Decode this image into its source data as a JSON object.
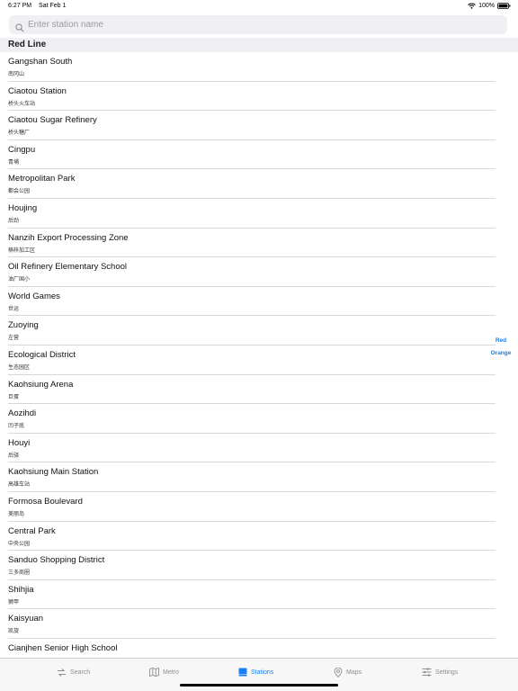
{
  "status_bar": {
    "time": "6:27 PM",
    "date": "Sat Feb 1",
    "battery": "100%"
  },
  "search": {
    "placeholder": "Enter station name",
    "value": ""
  },
  "section": {
    "title": "Red Line"
  },
  "stations": [
    {
      "name": "Gangshan South",
      "sub": "南冈山"
    },
    {
      "name": "Ciaotou Station",
      "sub": "桥头火车站"
    },
    {
      "name": "Ciaotou Sugar Refinery",
      "sub": "桥头糖厂"
    },
    {
      "name": "Cingpu",
      "sub": "青埔"
    },
    {
      "name": "Metropolitan Park",
      "sub": "都会公园"
    },
    {
      "name": "Houjing",
      "sub": "后劲"
    },
    {
      "name": "Nanzih Export Processing Zone",
      "sub": "楠梓加工区"
    },
    {
      "name": "Oil Refinery Elementary School",
      "sub": "油厂国小"
    },
    {
      "name": "World Games",
      "sub": "世运"
    },
    {
      "name": "Zuoying",
      "sub": "左营"
    },
    {
      "name": "Ecological District",
      "sub": "生态园区"
    },
    {
      "name": "Kaohsiung Arena",
      "sub": "巨蛋"
    },
    {
      "name": "Aozihdi",
      "sub": "凹子底"
    },
    {
      "name": "Houyi",
      "sub": "后驿"
    },
    {
      "name": "Kaohsiung Main Station",
      "sub": "高雄车站"
    },
    {
      "name": "Formosa Boulevard",
      "sub": "美丽岛"
    },
    {
      "name": "Central Park",
      "sub": "中央公园"
    },
    {
      "name": "Sanduo Shopping District",
      "sub": "三多商圈"
    },
    {
      "name": "Shihjia",
      "sub": "狮甲"
    },
    {
      "name": "Kaisyuan",
      "sub": "凯旋"
    },
    {
      "name": "Cianjhen Senior High School",
      "sub": ""
    }
  ],
  "side_index": [
    "Red",
    "Orange"
  ],
  "tabs": [
    {
      "label": "Search",
      "icon": "search-tab-icon",
      "active": false
    },
    {
      "label": "Metro",
      "icon": "map-tab-icon",
      "active": false
    },
    {
      "label": "Stations",
      "icon": "book-tab-icon",
      "active": true
    },
    {
      "label": "Maps",
      "icon": "pin-tab-icon",
      "active": false
    },
    {
      "label": "Settings",
      "icon": "sliders-tab-icon",
      "active": false
    }
  ],
  "colors": {
    "accent": "#1a7ff2",
    "inactive": "#8e8e93",
    "header_bg": "#efeff4"
  }
}
